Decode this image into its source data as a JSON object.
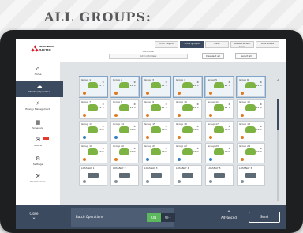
{
  "page_heading": "ALL GROUPS:",
  "header": {
    "logo_text": "MITSUBISHI\nELECTRIC",
    "tabs": [
      {
        "label": "Floor Layout"
      },
      {
        "label": "Show groups",
        "active": true
      },
      {
        "label": "Hvac"
      },
      {
        "label": "Measurement Areas"
      },
      {
        "label": "BMS Views"
      }
    ],
    "controller_label": "Controller",
    "controller_value": "All controllers",
    "deselect_all": "Deselect all",
    "select_all": "Select all"
  },
  "sidebar": {
    "items": [
      {
        "label": "Home",
        "icon": "home-icon",
        "glyph": "⌂"
      },
      {
        "label": "Monitor/Operation",
        "icon": "monitor-icon",
        "glyph": "☁",
        "active": true
      },
      {
        "label": "Energy Management",
        "icon": "energy-icon",
        "glyph": "⚡"
      },
      {
        "label": "Schedule",
        "icon": "calendar-icon",
        "glyph": "▦"
      },
      {
        "label": "Notice",
        "icon": "notice-icon",
        "glyph": "✉",
        "badge": true
      },
      {
        "label": "Settings",
        "icon": "gear-icon",
        "glyph": "⚙"
      },
      {
        "label": "Maintenance",
        "icon": "maintenance-icon",
        "glyph": "⚒"
      }
    ]
  },
  "tiles": [
    {
      "name": "Group 1",
      "temp": "22°C",
      "mode": "heat",
      "selected": true
    },
    {
      "name": "Group 2",
      "temp": "22°C",
      "mode": "heat",
      "selected": true
    },
    {
      "name": "Group 3",
      "temp": "22°C",
      "mode": "heat",
      "selected": true
    },
    {
      "name": "Group 4",
      "temp": "22°C",
      "mode": "heat",
      "selected": true
    },
    {
      "name": "Group 5",
      "temp": "22°C",
      "mode": "heat",
      "selected": true
    },
    {
      "name": "Group 6",
      "temp": "22°C",
      "mode": "heat",
      "selected": true
    },
    {
      "name": "Group 7",
      "temp": "22°C",
      "mode": "heat"
    },
    {
      "name": "Group 8",
      "temp": "22°C",
      "mode": "heat"
    },
    {
      "name": "Group 9",
      "temp": "22°C",
      "mode": "heat"
    },
    {
      "name": "Group 10",
      "temp": "22°C",
      "mode": "heat"
    },
    {
      "name": "Group 11",
      "temp": "22°C",
      "mode": "heat"
    },
    {
      "name": "Group 12",
      "temp": "22°C",
      "mode": "heat"
    },
    {
      "name": "Group 13",
      "temp": "22°C",
      "mode": "cool"
    },
    {
      "name": "Group 14",
      "temp": "22°C",
      "mode": "cool"
    },
    {
      "name": "Group 15",
      "temp": "22°C",
      "mode": "heat"
    },
    {
      "name": "Group 16",
      "temp": "22°C",
      "mode": "heat"
    },
    {
      "name": "Group 17",
      "temp": "22°C",
      "mode": "heat"
    },
    {
      "name": "Group 18",
      "temp": "22°C",
      "mode": "heat"
    },
    {
      "name": "Group 19",
      "temp": "22°C",
      "mode": "heat"
    },
    {
      "name": "Group 20",
      "temp": "22°C",
      "mode": "heat"
    },
    {
      "name": "Group 21",
      "temp": "22°C",
      "mode": "cool"
    },
    {
      "name": "Group 22",
      "temp": "22°C",
      "mode": "cool"
    },
    {
      "name": "Group 23",
      "temp": "22°C",
      "mode": "cool"
    },
    {
      "name": "Group 24",
      "temp": "22°C",
      "mode": "heat"
    },
    {
      "name": "LOSSNAY 1",
      "temp": "",
      "mode": "vent"
    },
    {
      "name": "LOSSNAY 2",
      "temp": "",
      "mode": "vent"
    },
    {
      "name": "LOSSNAY 3",
      "temp": "",
      "mode": "vent"
    },
    {
      "name": "LOSSNAY 4",
      "temp": "",
      "mode": "vent"
    },
    {
      "name": "LOSSNAY 5",
      "temp": "",
      "mode": "vent"
    },
    {
      "name": "LOSSNAY 6",
      "temp": "",
      "mode": "vent"
    }
  ],
  "bottombar": {
    "close_label": "Close",
    "batch_label": "Batch Operations",
    "on_label": "ON",
    "off_label": "OFF",
    "advanced_label": "Advanced",
    "send_label": "Send"
  },
  "colors": {
    "accent": "#3b4a5e",
    "on": "#5cb85c",
    "unit": "#7cb342",
    "heat": "#e07a1f",
    "cool": "#2f7fc1",
    "badge": "#e53b2c"
  }
}
